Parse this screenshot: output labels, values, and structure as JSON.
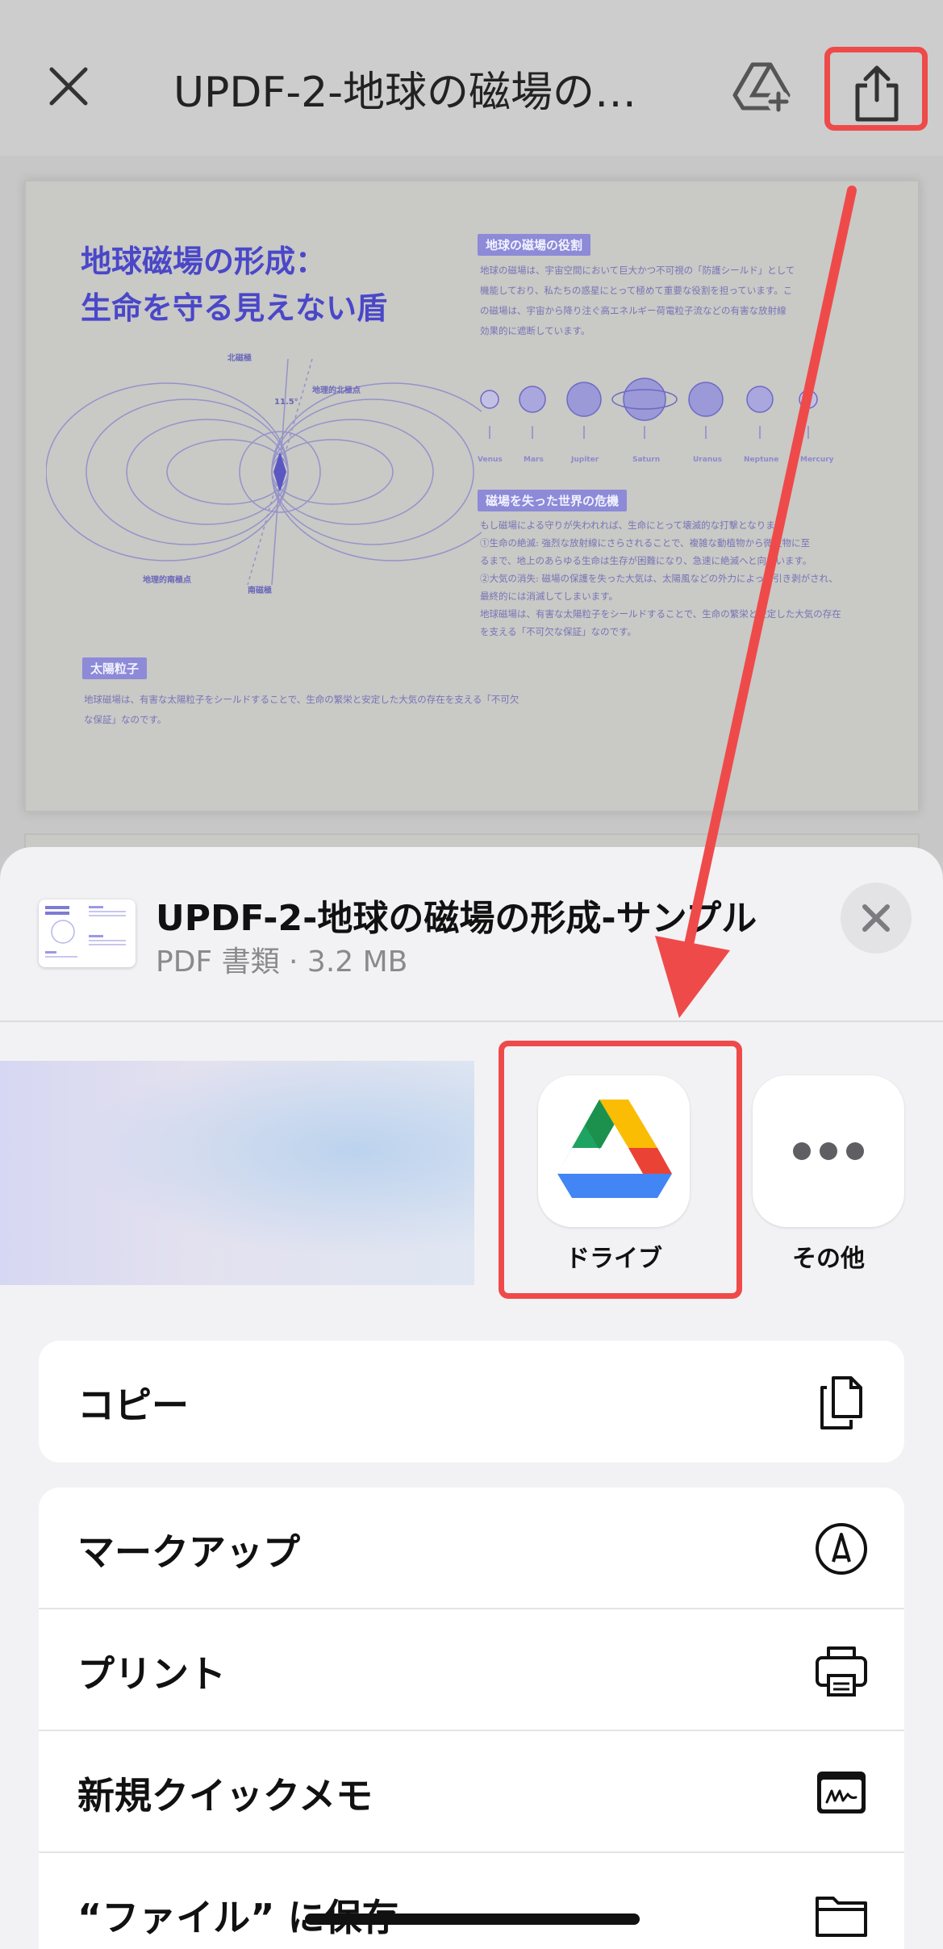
{
  "topbar": {
    "title": "UPDF-2-地球の磁場の…",
    "close_icon": "close-icon",
    "drive_add_icon": "drive-add-icon",
    "share_icon": "share-icon"
  },
  "document": {
    "title_line1": "地球磁場の形成：",
    "title_line2": "生命を守る見えない盾",
    "label_north_magnetic": "北磁極",
    "label_geo_north": "地理的北極点",
    "label_angle": "11.5°",
    "label_geo_south": "地理的南極点",
    "label_south_magnetic": "南磁極",
    "section_role": "地球の磁場の役割",
    "role_text": [
      "地球の磁場は、宇宙空間において巨大かつ不可視の「防護シールド」として",
      "機能しており、私たちの惑星にとって極めて重要な役割を担っています。こ",
      "の磁場は、宇宙から降り注ぐ高エネルギー荷電粒子流などの有害な放射線",
      "効果的に遮断しています。"
    ],
    "planets": [
      "Venus",
      "Mars",
      "Jupiter",
      "Saturn",
      "Uranus",
      "Neptune",
      "Mercury"
    ],
    "section_crisis": "磁場を失った世界の危機",
    "crisis_text": [
      "もし磁場による守りが失われれば、生命にとって壊滅的な打撃となります",
      "①生命の絶滅: 強烈な放射線にさらされることで、複雑な動植物から微生物に至",
      "るまで、地上のあらゆる生命は生存が困難になり、急速に絶滅へと向かいます。",
      "②大気の消失: 磁場の保護を失った大気は、太陽風などの外力によって引き剥がされ、",
      "最終的には消滅してしまいます。",
      "地球磁場は、有害な太陽粒子をシールドすることで、生命の繁栄と安定した大気の存在",
      "を支える「不可欠な保証」なのです。"
    ],
    "section_solar": "太陽粒子",
    "solar_text": [
      "地球磁場は、有害な太陽粒子をシールドすることで、生命の繁栄と安定した大気の存在を支える「不可欠",
      "な保証」なのです。"
    ]
  },
  "sheet": {
    "file_name": "UPDF-2-地球の磁場の形成-サンプル",
    "file_meta": "PDF 書類 · 3.2 MB",
    "apps": [
      {
        "label": "ドライブ",
        "icon": "google-drive-icon"
      },
      {
        "label": "その他",
        "icon": "more-icon"
      }
    ],
    "actions_group1": [
      {
        "label": "コピー",
        "icon": "copy-icon"
      }
    ],
    "actions_group2": [
      {
        "label": "マークアップ",
        "icon": "markup-icon"
      },
      {
        "label": "プリント",
        "icon": "print-icon"
      },
      {
        "label": "新規クイックメモ",
        "icon": "quick-note-icon"
      },
      {
        "label": "“ファイル” に保存",
        "icon": "folder-icon"
      }
    ]
  },
  "colors": {
    "highlight": "#ef4a4a",
    "doc_accent": "#4a47c9"
  }
}
